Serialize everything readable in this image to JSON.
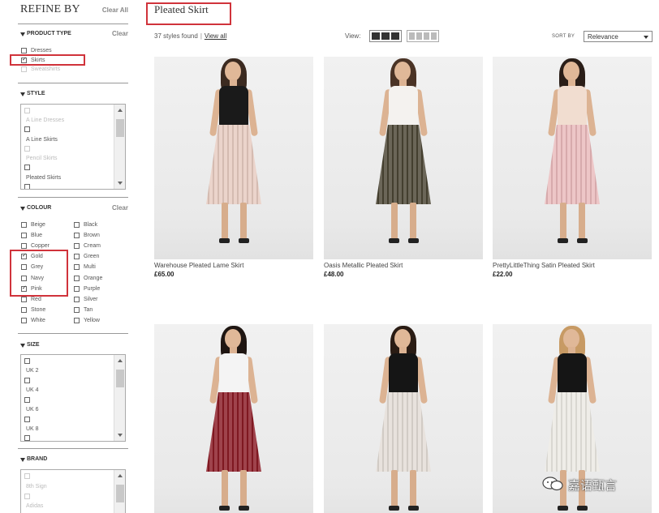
{
  "sidebar": {
    "title": "REFINE BY",
    "clear_all": "Clear All",
    "product_type": {
      "heading": "PRODUCT TYPE",
      "clear": "Clear",
      "options": [
        {
          "label": "Dresses",
          "checked": false,
          "dim": false
        },
        {
          "label": "Skirts",
          "checked": true,
          "dim": false
        },
        {
          "label": "Sweatshirts",
          "checked": false,
          "dim": true
        }
      ]
    },
    "style": {
      "heading": "STYLE",
      "options": [
        {
          "label": "A Line Dresses",
          "dim": true
        },
        {
          "label": "A Line Skirts",
          "dim": false
        },
        {
          "label": "Pencil Skirts",
          "dim": true
        },
        {
          "label": "Pleated Skirts",
          "dim": false
        }
      ]
    },
    "colour": {
      "heading": "COLOUR",
      "clear": "Clear",
      "left": [
        {
          "label": "Beige",
          "checked": false
        },
        {
          "label": "Blue",
          "checked": false
        },
        {
          "label": "Copper",
          "checked": false
        },
        {
          "label": "Gold",
          "checked": true
        },
        {
          "label": "Grey",
          "checked": false
        },
        {
          "label": "Navy",
          "checked": false
        },
        {
          "label": "Pink",
          "checked": true
        },
        {
          "label": "Red",
          "checked": false
        },
        {
          "label": "Stone",
          "checked": false
        },
        {
          "label": "White",
          "checked": false
        }
      ],
      "right": [
        {
          "label": "Black",
          "checked": false
        },
        {
          "label": "Brown",
          "checked": false
        },
        {
          "label": "Cream",
          "checked": false
        },
        {
          "label": "Green",
          "checked": false
        },
        {
          "label": "Multi",
          "checked": false
        },
        {
          "label": "Orange",
          "checked": false
        },
        {
          "label": "Purple",
          "checked": false
        },
        {
          "label": "Silver",
          "checked": false
        },
        {
          "label": "Tan",
          "checked": false
        },
        {
          "label": "Yellow",
          "checked": false
        }
      ]
    },
    "size": {
      "heading": "SIZE",
      "options": [
        "UK 2",
        "UK 4",
        "UK 6",
        "UK 8"
      ]
    },
    "brand": {
      "heading": "BRAND",
      "options": [
        "8th Sign",
        "Adidas"
      ]
    }
  },
  "main": {
    "title": "Pleated Skirt",
    "count": "37 styles found",
    "view_all": "View all",
    "view_label": "View:",
    "sort_label": "SORT BY",
    "sort_value": "Relevance"
  },
  "products": [
    {
      "name": "Warehouse Pleated Lame Skirt",
      "price": "£65.00",
      "skirt_color": "#e6cbc0",
      "top_color": "#1a1a1a"
    },
    {
      "name": "Oasis Metallic Pleated Skirt",
      "price": "£48.00",
      "skirt_color": "#4a4433",
      "top_color": "#f4f2ef"
    },
    {
      "name": "PrettyLittleThing Satin Pleated Skirt",
      "price": "£22.00",
      "skirt_color": "#e9b9bb",
      "top_color": "#f1ddd0"
    },
    {
      "name": "",
      "price": "",
      "skirt_color": "#8a1a24",
      "top_color": "#f4f4f4"
    },
    {
      "name": "",
      "price": "",
      "skirt_color": "#e3dcd6",
      "top_color": "#151515"
    },
    {
      "name": "",
      "price": "",
      "skirt_color": "#ece9e3",
      "top_color": "#151515"
    }
  ],
  "watermark": {
    "text": "嘉语甄言"
  },
  "colors": {
    "highlight": "#d0333b",
    "text": "#333333",
    "muted": "#888888"
  }
}
